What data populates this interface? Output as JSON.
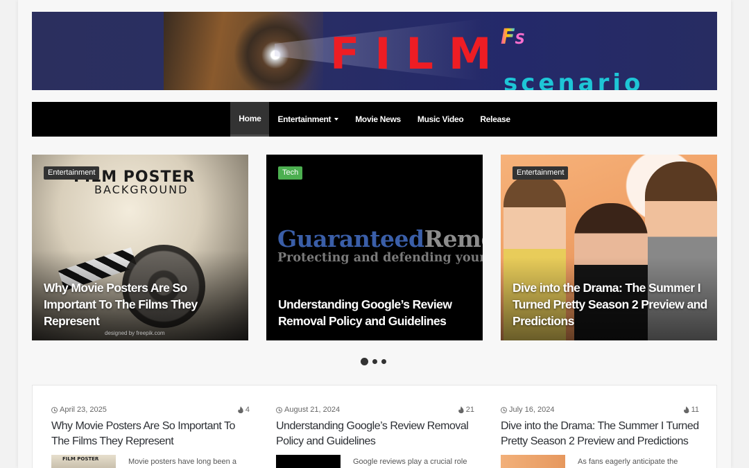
{
  "site": {
    "logo_film": "FILM",
    "logo_fs_f": "F",
    "logo_fs_s": "S",
    "logo_scenario": "scenario"
  },
  "nav": {
    "items": [
      {
        "label": "Home",
        "active": true
      },
      {
        "label": "Entertainment",
        "dropdown": true
      },
      {
        "label": "Movie News"
      },
      {
        "label": "Music Video"
      },
      {
        "label": "Release"
      }
    ]
  },
  "slides": [
    {
      "category": "Entertainment",
      "title": "Why Movie Posters Are So Important To The Films They Represent",
      "image_text_1": "FILM POSTER",
      "image_text_2": "BACKGROUND",
      "image_credit": "designed by freepik.com"
    },
    {
      "category": "Tech",
      "title": "Understanding Google’s Review Removal Policy and Guidelines",
      "image_text_1a": "Guaranteed",
      "image_text_1b": "Remo",
      "image_text_2": "Protecting and defending your ima"
    },
    {
      "category": "Entertainment",
      "title": "Dive into the Drama: The Summer I Turned Pretty Season 2 Preview and Predictions"
    }
  ],
  "slider_dots": {
    "count": 3,
    "active": 0
  },
  "posts": [
    {
      "date": "April 23, 2025",
      "views": "4",
      "title": "Why Movie Posters Are So Important To The Films They Represent",
      "excerpt": "Movie posters have long been a",
      "thumb_text": "FILM POSTER"
    },
    {
      "date": "August 21, 2024",
      "views": "21",
      "title": "Understanding Google’s Review Removal Policy and Guidelines",
      "excerpt": "Google reviews play a crucial role in"
    },
    {
      "date": "July 16, 2024",
      "views": "11",
      "title": "Dive into the Drama: The Summer I Turned Pretty Season 2 Preview and Predictions",
      "excerpt": "As fans eagerly anticipate the return"
    }
  ],
  "colors": {
    "nav_bg": "#000000",
    "logo_red": "#ee1d24",
    "logo_cyan": "#1ec6d6",
    "tech_badge": "#4caf50",
    "category_badge": "#333333"
  }
}
